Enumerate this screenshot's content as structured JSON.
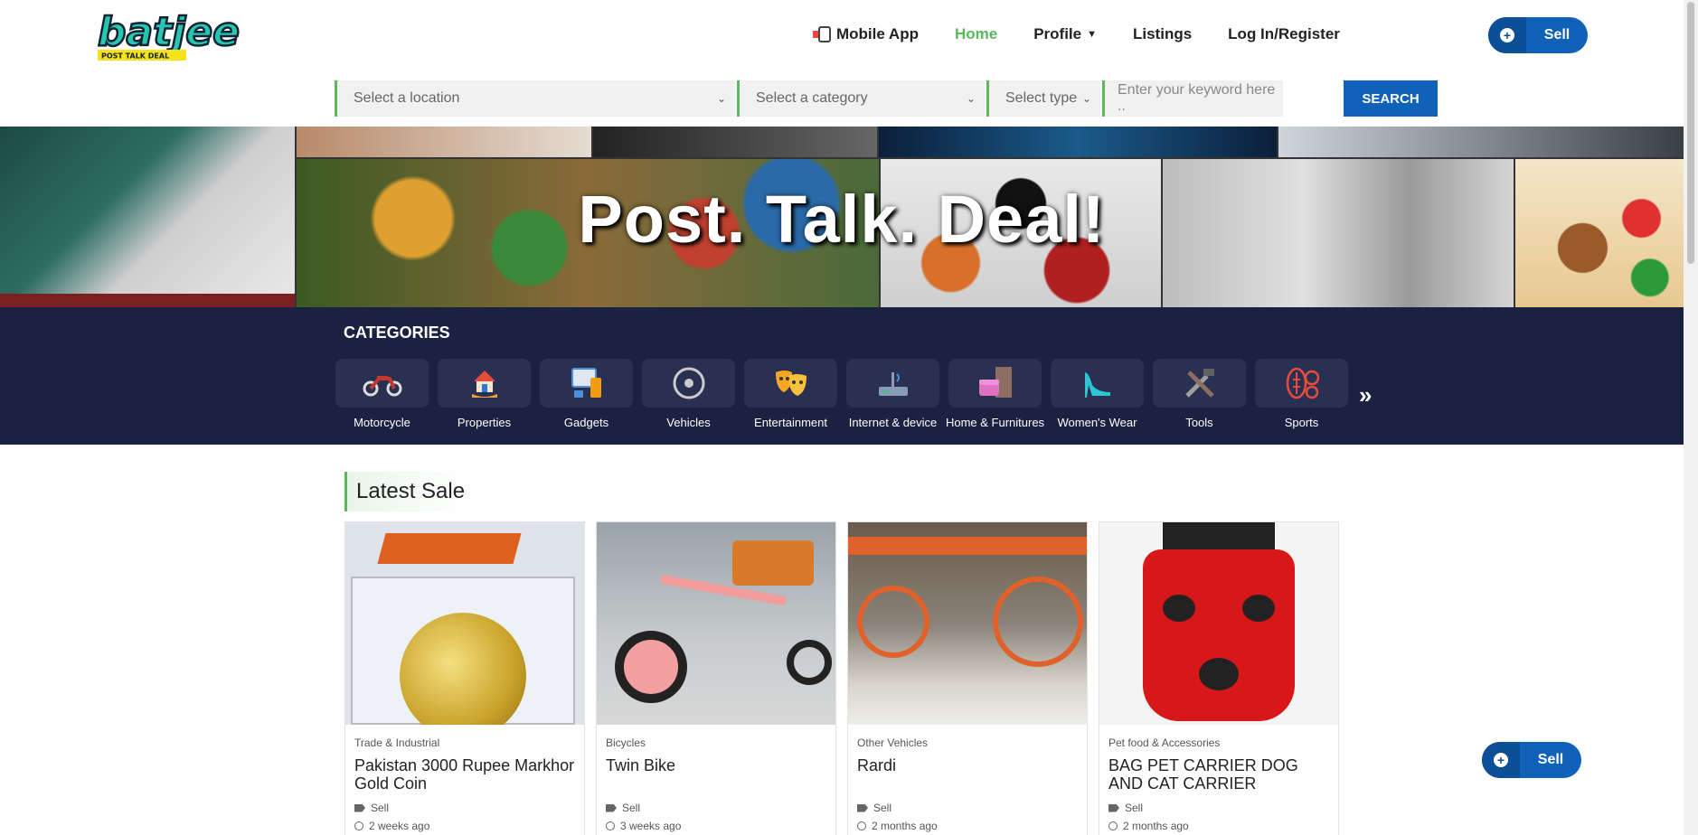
{
  "header": {
    "logo_text": "batjee",
    "logo_tagline": "POST TALK DEAL",
    "nav": [
      {
        "label": "Mobile App"
      },
      {
        "label": "Home"
      },
      {
        "label": "Profile"
      },
      {
        "label": "Listings"
      },
      {
        "label": "Log In/Register"
      }
    ],
    "sell_label": "Sell"
  },
  "search": {
    "location_placeholder": "Select a location",
    "category_placeholder": "Select a category",
    "type_placeholder": "Select type",
    "keyword_placeholder": "Enter your keyword here ..",
    "button_label": "SEARCH"
  },
  "hero": {
    "title": "Post. Talk. Deal!"
  },
  "categories": {
    "heading": "CATEGORIES",
    "items": [
      {
        "label": "Motorcycle",
        "icon": "motorcycle-icon"
      },
      {
        "label": "Properties",
        "icon": "house-icon"
      },
      {
        "label": "Gadgets",
        "icon": "devices-icon"
      },
      {
        "label": "Vehicles",
        "icon": "wheel-icon"
      },
      {
        "label": "Entertainment",
        "icon": "theater-masks-icon"
      },
      {
        "label": "Internet & device",
        "icon": "router-icon"
      },
      {
        "label": "Home & Furnitures",
        "icon": "furniture-icon"
      },
      {
        "label": "Women's Wear",
        "icon": "high-heel-icon"
      },
      {
        "label": "Tools",
        "icon": "tools-icon"
      },
      {
        "label": "Sports",
        "icon": "sports-balls-icon"
      }
    ]
  },
  "latest": {
    "heading": "Latest Sale",
    "listings": [
      {
        "category": "Trade & Industrial",
        "title": "Pakistan 3000 Rupee Markhor Gold Coin",
        "type": "Sell",
        "time": "2 weeks ago"
      },
      {
        "category": "Bicycles",
        "title": "Twin Bike",
        "type": "Sell",
        "time": "3 weeks ago"
      },
      {
        "category": "Other Vehicles",
        "title": "Rardi",
        "type": "Sell",
        "time": "2 months ago"
      },
      {
        "category": "Pet food & Accessories",
        "title": "BAG PET CARRIER DOG AND CAT CARRIER",
        "type": "Sell",
        "time": "2 months ago"
      }
    ]
  },
  "floating_sell_label": "Sell",
  "colors": {
    "brand_blue": "#0f62b7",
    "accent_green": "#5cb85c",
    "categories_bg": "#1b2141"
  }
}
